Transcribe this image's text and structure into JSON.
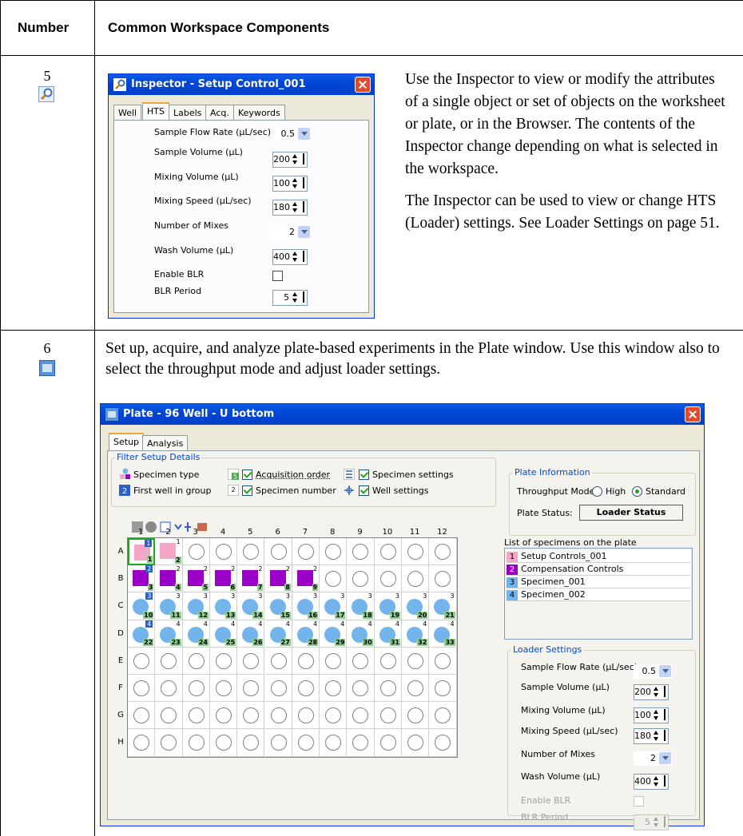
{
  "table": {
    "header_number": "Number",
    "header_components": "Common Workspace Components"
  },
  "row5": {
    "number": "5",
    "icon": "inspector-magnifier-icon",
    "paragraphs": [
      "Use the Inspector to view or modify the attributes of a single object or set of objects on the worksheet or plate, or in the Browser. The contents of the Inspector change depending on what is selected in the workspace.",
      "The Inspector can be used to view or change HTS (Loader) settings. See Loader Settings on page 51."
    ],
    "inspector": {
      "title": "Inspector - Setup Control_001",
      "tabs": [
        "Well",
        "HTS",
        "Labels",
        "Acq.",
        "Keywords"
      ],
      "active_tab": "HTS",
      "fields": [
        {
          "label": "Sample Flow Rate (µL/sec)",
          "value": "0.5",
          "kind": "dropdown"
        },
        {
          "label": "Sample Volume (µL)",
          "value": "200",
          "kind": "spinner"
        },
        {
          "label": "Mixing Volume (µL)",
          "value": "100",
          "kind": "spinner"
        },
        {
          "label": "Mixing Speed (µL/sec)",
          "value": "180",
          "kind": "spinner"
        },
        {
          "label": "Number of Mixes",
          "value": "2",
          "kind": "dropdown"
        },
        {
          "label": "Wash Volume (µL)",
          "value": "400",
          "kind": "spinner"
        },
        {
          "label": "Enable BLR",
          "value": "",
          "kind": "checkbox"
        },
        {
          "label": "BLR Period",
          "value": "5",
          "kind": "spinner"
        }
      ]
    }
  },
  "row6": {
    "number": "6",
    "icon": "plate-window-icon",
    "paragraph": "Set up, acquire, and analyze plate-based experiments in the Plate window. Use this window also to select the throughput mode and adjust loader settings.",
    "plate_window": {
      "title": "Plate - 96 Well - U bottom",
      "tabs": [
        "Setup",
        "Analysis"
      ],
      "filter_group_title": "Filter Setup Details",
      "filters": {
        "specimen_type": "Specimen type",
        "first_well": "First well in group",
        "acquisition_order": "Acquisition order",
        "specimen_number": "Specimen number",
        "specimen_settings": "Specimen settings",
        "well_settings": "Well settings"
      },
      "plate_info": {
        "title": "Plate Information",
        "throughput_label": "Throughput Mode",
        "high": "High",
        "standard": "Standard",
        "status_label": "Plate Status:",
        "status_button": "Loader Status"
      },
      "specimen_list_title": "List of specimens on the plate",
      "specimens": [
        {
          "n": "1",
          "name": "Setup Controls_001",
          "color": "#f4a6c8"
        },
        {
          "n": "2",
          "name": "Compensation Controls",
          "color": "#9b00c9"
        },
        {
          "n": "3",
          "name": "Specimen_001",
          "color": "#74b4ec"
        },
        {
          "n": "4",
          "name": "Specimen_002",
          "color": "#74b4ec"
        }
      ],
      "loader_title": "Loader Settings",
      "loader_fields": [
        {
          "label": "Sample Flow Rate (µL/sec)",
          "value": "0.5",
          "kind": "dropdown"
        },
        {
          "label": "Sample Volume (µL)",
          "value": "200",
          "kind": "spinner"
        },
        {
          "label": "Mixing Volume (µL)",
          "value": "100",
          "kind": "spinner"
        },
        {
          "label": "Mixing Speed (µL/sec)",
          "value": "180",
          "kind": "spinner"
        },
        {
          "label": "Number of Mixes",
          "value": "2",
          "kind": "dropdown"
        },
        {
          "label": "Wash Volume (µL)",
          "value": "400",
          "kind": "spinner"
        },
        {
          "label": "Enable BLR",
          "value": "",
          "kind": "checkbox-disabled"
        },
        {
          "label": "BLR Period",
          "value": "5",
          "kind": "spinner-disabled"
        }
      ],
      "columns": [
        "1",
        "2",
        "3",
        "4",
        "5",
        "6",
        "7",
        "8",
        "9",
        "10",
        "11",
        "12"
      ],
      "rows": [
        "A",
        "B",
        "C",
        "D",
        "E",
        "F",
        "G",
        "H"
      ],
      "wells": {
        "A": [
          {
            "spec": "1",
            "order": "1",
            "kind": "pink",
            "first": true
          },
          {
            "spec": "1",
            "order": "2",
            "kind": "pink"
          }
        ],
        "B": [
          {
            "spec": "2",
            "order": "3",
            "kind": "purple",
            "first": true
          },
          {
            "spec": "2",
            "order": "4",
            "kind": "purple"
          },
          {
            "spec": "2",
            "order": "5",
            "kind": "purple"
          },
          {
            "spec": "2",
            "order": "6",
            "kind": "purple"
          },
          {
            "spec": "2",
            "order": "7",
            "kind": "purple"
          },
          {
            "spec": "2",
            "order": "8",
            "kind": "purple"
          },
          {
            "spec": "2",
            "order": "9",
            "kind": "purple"
          }
        ],
        "C": [
          {
            "spec": "3",
            "order": "10",
            "kind": "blue",
            "first": true
          },
          {
            "spec": "3",
            "order": "11",
            "kind": "blue"
          },
          {
            "spec": "3",
            "order": "12",
            "kind": "blue"
          },
          {
            "spec": "3",
            "order": "13",
            "kind": "blue"
          },
          {
            "spec": "3",
            "order": "14",
            "kind": "blue"
          },
          {
            "spec": "3",
            "order": "15",
            "kind": "blue"
          },
          {
            "spec": "3",
            "order": "16",
            "kind": "blue"
          },
          {
            "spec": "3",
            "order": "17",
            "kind": "blue"
          },
          {
            "spec": "3",
            "order": "18",
            "kind": "blue"
          },
          {
            "spec": "3",
            "order": "19",
            "kind": "blue"
          },
          {
            "spec": "3",
            "order": "20",
            "kind": "blue"
          },
          {
            "spec": "3",
            "order": "21",
            "kind": "blue"
          }
        ],
        "D": [
          {
            "spec": "4",
            "order": "22",
            "kind": "blue",
            "first": true
          },
          {
            "spec": "4",
            "order": "23",
            "kind": "blue"
          },
          {
            "spec": "4",
            "order": "24",
            "kind": "blue"
          },
          {
            "spec": "4",
            "order": "25",
            "kind": "blue"
          },
          {
            "spec": "4",
            "order": "26",
            "kind": "blue"
          },
          {
            "spec": "4",
            "order": "27",
            "kind": "blue"
          },
          {
            "spec": "4",
            "order": "28",
            "kind": "blue"
          },
          {
            "spec": "4",
            "order": "29",
            "kind": "blue"
          },
          {
            "spec": "4",
            "order": "30",
            "kind": "blue"
          },
          {
            "spec": "4",
            "order": "31",
            "kind": "blue"
          },
          {
            "spec": "4",
            "order": "32",
            "kind": "blue"
          },
          {
            "spec": "4",
            "order": "33",
            "kind": "blue"
          }
        ]
      }
    }
  }
}
